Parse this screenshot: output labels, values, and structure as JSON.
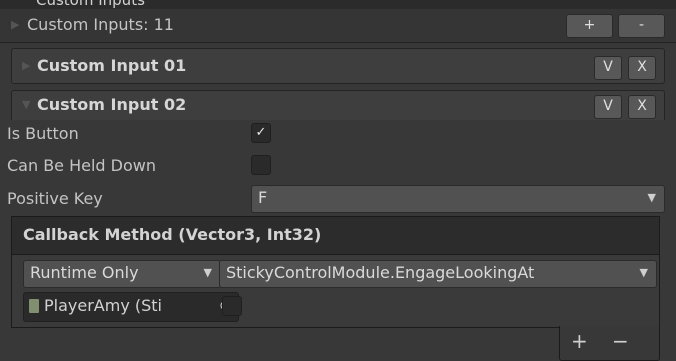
{
  "top_cut_label": "Custom Inputs",
  "list": {
    "header_label": "Custom Inputs: 11",
    "add_label": "+",
    "remove_label": "-"
  },
  "input_01": {
    "title": "Custom Input 01",
    "v_label": "V",
    "x_label": "X"
  },
  "input_02": {
    "title": "Custom Input 02",
    "v_label": "V",
    "x_label": "X",
    "is_button_label": "Is Button",
    "is_button_checked": true,
    "check_glyph": "✓",
    "held_label": "Can Be Held Down",
    "held_checked": false,
    "positive_key_label": "Positive Key",
    "positive_key_value": "F"
  },
  "callback": {
    "title": "Callback Method (Vector3, Int32)",
    "runtime_value": "Runtime Only",
    "method_value": "StickyControlModule.EngageLookingAt",
    "object_value": "PlayerAmy (Sti",
    "object_target_icon": "⊙",
    "arg_checked": false,
    "add_label": "+",
    "remove_label": "−"
  },
  "icons": {
    "foldout_collapsed": "▶",
    "foldout_expanded": "▼",
    "dropdown_caret": "▼"
  }
}
